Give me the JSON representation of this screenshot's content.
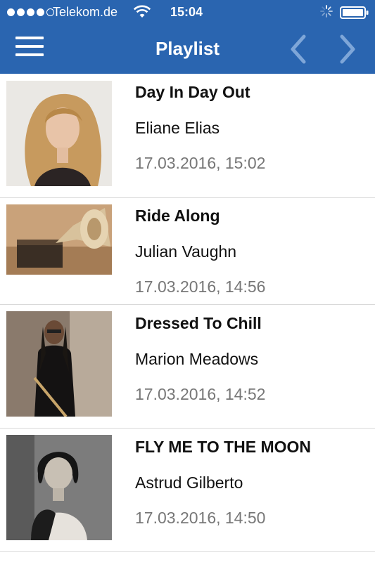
{
  "status_bar": {
    "carrier": "Telekom.de",
    "time": "15:04",
    "signal_bars": 4,
    "signal_max": 5
  },
  "nav": {
    "title": "Playlist",
    "menu_icon": "hamburger-menu-icon",
    "prev_icon": "chevron-left-icon",
    "next_icon": "chevron-right-icon"
  },
  "colors": {
    "header": "#2a65b0",
    "separator": "#d9d9d9",
    "time_text": "#777777"
  },
  "playlist": [
    {
      "title": "Day In Day Out",
      "artist": "Eliane Elias",
      "played": "17.03.2016, 15:02"
    },
    {
      "title": "Ride Along",
      "artist": "Julian Vaughn",
      "played": "17.03.2016, 14:56"
    },
    {
      "title": "Dressed To Chill",
      "artist": "Marion Meadows",
      "played": "17.03.2016, 14:52"
    },
    {
      "title": "FLY ME TO THE MOON",
      "artist": "Astrud Gilberto",
      "played": "17.03.2016, 14:50"
    }
  ]
}
